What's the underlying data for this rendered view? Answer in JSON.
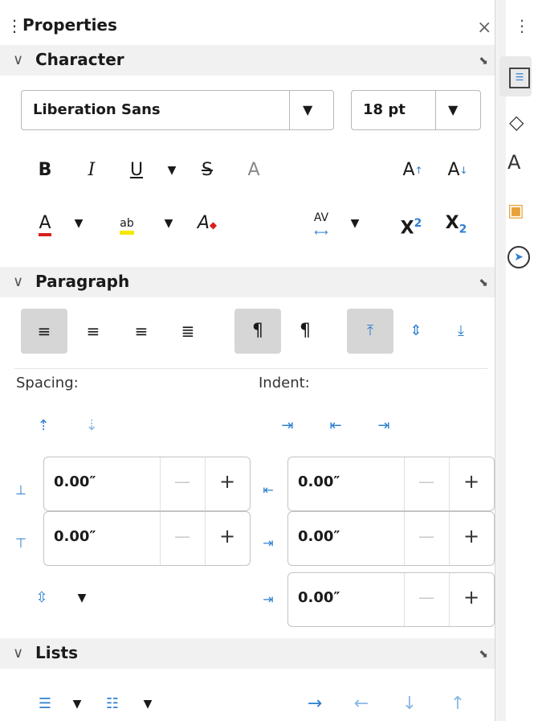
{
  "panel": {
    "title": "Properties",
    "close_glyph": "×",
    "grip_glyph": "⋮"
  },
  "character": {
    "section_title": "Character",
    "font_name": "Liberation Sans",
    "font_size": "18 pt",
    "bold": "B",
    "italic": "I",
    "underline": "U",
    "strike": "S",
    "shadow": "A",
    "grow": "A",
    "shrink": "A",
    "font_color": "A",
    "highlight": "ab",
    "clear": "A",
    "spacing": "AV",
    "superscript": "X",
    "superscript_exp": "2",
    "subscript": "X",
    "subscript_exp": "2"
  },
  "paragraph": {
    "section_title": "Paragraph",
    "spacing_label": "Spacing:",
    "indent_label": "Indent:",
    "above_spacing": "0.00″",
    "below_spacing": "0.00″",
    "before_indent": "0.00″",
    "after_indent": "0.00″",
    "first_line_indent": "0.00″",
    "minus": "—",
    "plus": "+"
  },
  "lists": {
    "section_title": "Lists"
  },
  "colors": {
    "accent": "#2f7fd1",
    "font_red": "#d92020",
    "highlight_yellow": "#f5e800"
  }
}
